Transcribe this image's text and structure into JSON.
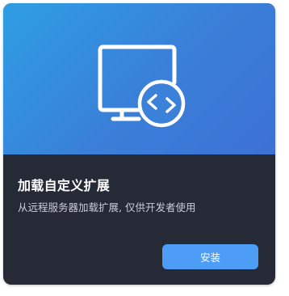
{
  "card": {
    "title": "加载自定义扩展",
    "description": "从远程服务器加载扩展, 仅供开发者使用",
    "install_label": "安装",
    "icon": "remote-monitor-icon"
  },
  "colors": {
    "hero_gradient_start": "#2e9ee3",
    "hero_gradient_end": "#3d71d4",
    "card_background": "#262a36",
    "button": "#4d9cf6"
  }
}
